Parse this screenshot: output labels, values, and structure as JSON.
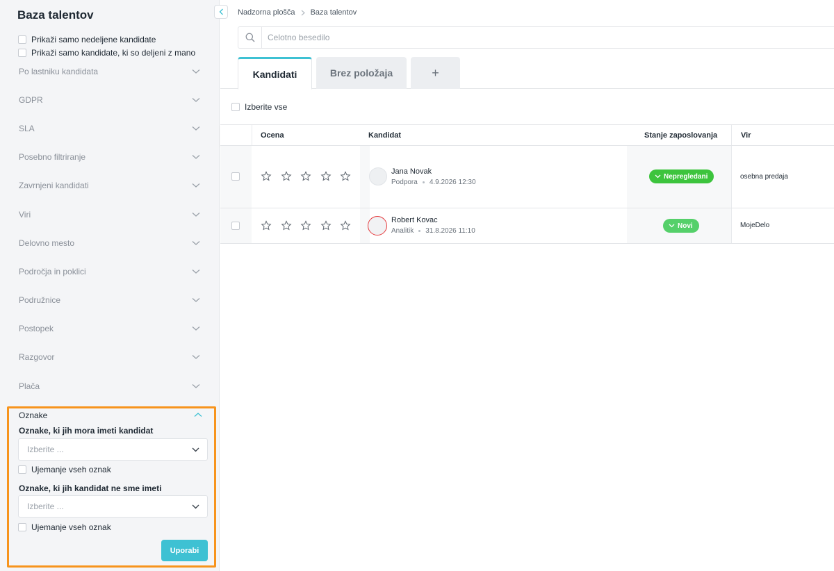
{
  "sidebar": {
    "title": "Baza talentov",
    "checkboxes": [
      "Prikaži samo nedeljene kandidate",
      "Prikaži samo kandidate, ki so deljeni z mano"
    ],
    "filters": [
      "Po lastniku kandidata",
      "GDPR",
      "SLA",
      "Posebno filtriranje",
      "Zavrnjeni kandidati",
      "Viri",
      "Delovno mesto",
      "Področja in poklici",
      "Podružnice",
      "Postopek",
      "Razgovor",
      "Plača"
    ],
    "tags": {
      "title": "Oznake",
      "must_have_label": "Oznake, ki jih mora imeti kandidat",
      "must_have_placeholder": "Izberite ...",
      "must_have_match_all": "Ujemanje vseh oznak",
      "must_not_label": "Oznake, ki jih kandidat ne sme imeti",
      "must_not_placeholder": "Izberite ...",
      "must_not_match_all": "Ujemanje vseh oznak",
      "apply_label": "Uporabi"
    }
  },
  "breadcrumb": [
    "Nadzorna plošča",
    "Baza talentov"
  ],
  "search": {
    "placeholder": "Celotno besedilo"
  },
  "tabs": [
    {
      "label": "Kandidati",
      "active": true
    },
    {
      "label": "Brez položaja",
      "active": false
    },
    {
      "label": "+",
      "active": false
    }
  ],
  "select_all_label": "Izberite vse",
  "table": {
    "headers": [
      "Ocena",
      "Kandidat",
      "Stanje zaposlovanja",
      "Vir"
    ],
    "rows": [
      {
        "name": "Jana Novak",
        "role": "Podpora",
        "date": "4.9.2026 12:30",
        "rating": 0,
        "status": "Nepregledani",
        "status_color": "#3dc43d",
        "source": "osebna predaja"
      },
      {
        "name": "Robert Kovac",
        "role": "Analitik",
        "date": "31.8.2026 11:10",
        "rating": 0,
        "status": "Novi",
        "status_color": "#55d06a",
        "source": "MojeDelo"
      }
    ]
  },
  "colors": {
    "accent": "#3ec1d3",
    "highlight": "#f7941d",
    "avatar_alert": "#e5393c"
  }
}
